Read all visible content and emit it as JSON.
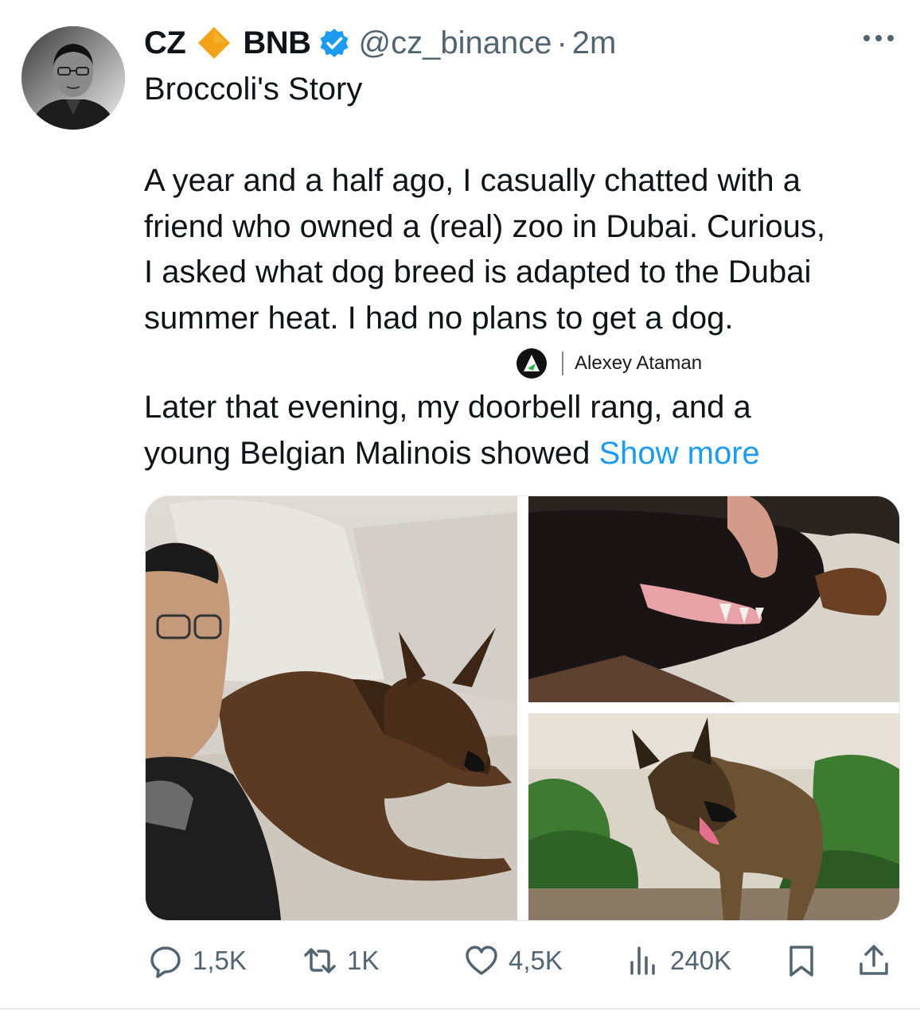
{
  "author": {
    "name": "CZ",
    "badge_token": "BNB",
    "handle": "@cz_binance",
    "separator": "·",
    "time": "2m",
    "diamond_icon": "bnb-diamond-icon",
    "verified_icon": "verified-badge-icon",
    "diamond_color": "#f3a416",
    "verified_color": "#1d9bf0"
  },
  "tweet": {
    "title": "Broccoli's Story",
    "paragraph1": [
      "A year and a half ago, I casually chatted with a",
      "friend who owned a (real) zoo in Dubai. Curious,",
      "I asked what dog breed is adapted to the Dubai",
      "summer heat. I had no plans to get a dog."
    ],
    "paragraph2": [
      "Later that evening, my doorbell rang, and a",
      "young Belgian Malinois showed"
    ],
    "show_more": "Show more",
    "link_color": "#1d9bf0"
  },
  "watermark": {
    "text": "Alexey Ataman",
    "logo_icon": "alexey-ataman-logo"
  },
  "media": [
    {
      "description_icon": "selfie-with-puppy-photo"
    },
    {
      "description_icon": "dog-teeth-closeup-photo"
    },
    {
      "description_icon": "dog-in-garden-photo"
    }
  ],
  "actions": {
    "reply_count": "1,5K",
    "retweet_count": "1K",
    "like_count": "4,5K",
    "views_count": "240K",
    "icon_color": "#536471"
  }
}
